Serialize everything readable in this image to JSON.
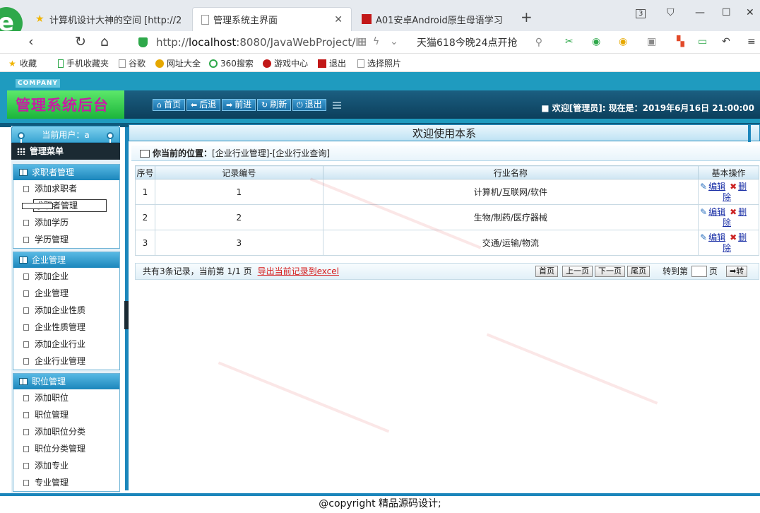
{
  "browser": {
    "tabs": [
      {
        "title": "计算机设计大神的空间 [http://2"
      },
      {
        "title": "管理系统主界面"
      },
      {
        "title": "A01安卓Android原生母语学习"
      }
    ],
    "tab_count": "3",
    "url_host": "localhost",
    "url_prefix": "http://",
    "url_suffix": ":8080/JavaWebProject/l",
    "search_text": "天猫618今晚24点开抢",
    "bookmarks": [
      "收藏",
      "手机收藏夹",
      "谷歌",
      "网址大全",
      "360搜索",
      "游戏中心",
      "退出",
      "选择照片"
    ]
  },
  "header": {
    "company": "COMPANY",
    "app_title": "管理系统后台",
    "toolbar": [
      "首页",
      "后退",
      "前进",
      "刷新",
      "退出"
    ],
    "welcome": "欢迎[管理员]:  现在是：2019年6月16日 21:00:00"
  },
  "sidebar": {
    "current_user": "当前用户：a",
    "menu_title": "管理菜单",
    "groups": [
      {
        "title": "求职者管理",
        "items": [
          "添加求职者",
          "求职者管理",
          "添加学历",
          "学历管理"
        ]
      },
      {
        "title": "企业管理",
        "items": [
          "添加企业",
          "企业管理",
          "添加企业性质",
          "企业性质管理",
          "添加企业行业",
          "企业行业管理"
        ]
      },
      {
        "title": "职位管理",
        "items": [
          "添加职位",
          "职位管理",
          "添加职位分类",
          "职位分类管理",
          "添加专业",
          "专业管理"
        ]
      }
    ]
  },
  "main": {
    "title": "欢迎使用本系",
    "location_label": "你当前的位置：",
    "location_path": "[企业行业管理]-[企业行业查询]",
    "columns": [
      "序号",
      "记录编号",
      "行业名称",
      "基本操作"
    ],
    "rows": [
      {
        "index": "1",
        "record_no": "1",
        "name": "计算机/互联网/软件"
      },
      {
        "index": "2",
        "record_no": "2",
        "name": "生物/制药/医疗器械"
      },
      {
        "index": "3",
        "record_no": "3",
        "name": "交通/运输/物流"
      }
    ],
    "edit_label": "编辑",
    "delete_label_a": "删",
    "delete_label_b": "除",
    "pager": {
      "summary": "共有3条记录，当前第 1/1 页",
      "export": "导出当前记录到excel",
      "first": "首页",
      "prev": "上一页",
      "next": "下一页",
      "last": "尾页",
      "goto_label": "转到第",
      "page_unit": "页",
      "go": "➡转"
    }
  },
  "footer": "@copyright 精品源码设计;"
}
